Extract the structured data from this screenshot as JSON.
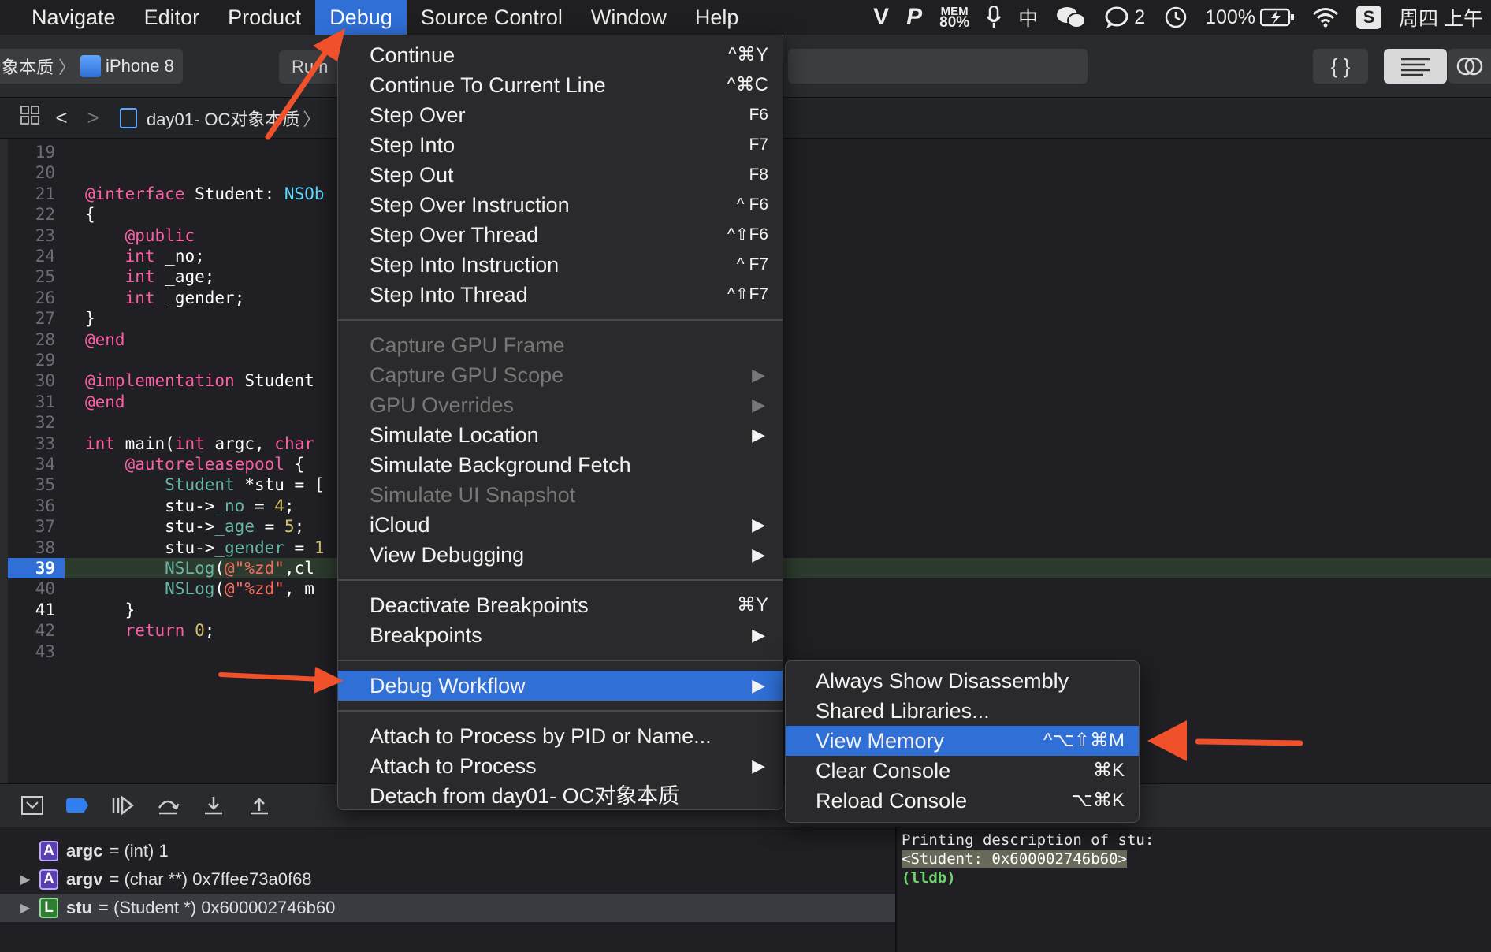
{
  "menubar": {
    "items": [
      "Navigate",
      "Editor",
      "Product",
      "Debug",
      "Source Control",
      "Window",
      "Help"
    ],
    "status": {
      "mem_label": "MEM",
      "mem_value": "80%",
      "input_method": "中",
      "chat_count": "2",
      "battery": "100%",
      "date": "周四 上午"
    }
  },
  "toolbar": {
    "scheme_project": "象本质",
    "scheme_device": "iPhone 8",
    "run_partial": "Ru n"
  },
  "jumpbar": {
    "path": "day01- OC对象本质"
  },
  "editor": {
    "current_line": 39,
    "lines": [
      {
        "n": "19",
        "code": ""
      },
      {
        "n": "20",
        "code": ""
      },
      {
        "n": "21",
        "code": "@interface Student: NSOb"
      },
      {
        "n": "22",
        "code": "{"
      },
      {
        "n": "23",
        "code": "    @public"
      },
      {
        "n": "24",
        "code": "    int _no;"
      },
      {
        "n": "25",
        "code": "    int _age;"
      },
      {
        "n": "26",
        "code": "    int _gender;"
      },
      {
        "n": "27",
        "code": "}"
      },
      {
        "n": "28",
        "code": "@end"
      },
      {
        "n": "29",
        "code": ""
      },
      {
        "n": "30",
        "code": "@implementation Student"
      },
      {
        "n": "31",
        "code": "@end"
      },
      {
        "n": "32",
        "code": ""
      },
      {
        "n": "33",
        "code": "int main(int argc, char"
      },
      {
        "n": "34",
        "code": "    @autoreleasepool {"
      },
      {
        "n": "35",
        "code": "        Student *stu = ["
      },
      {
        "n": "36",
        "code": "        stu->_no = 4;"
      },
      {
        "n": "37",
        "code": "        stu->_age = 5;"
      },
      {
        "n": "38",
        "code": "        stu->_gender = 1"
      },
      {
        "n": "39",
        "code": "        NSLog(@\"%zd\",cl"
      },
      {
        "n": "40",
        "code": "        NSLog(@\"%zd\", m"
      },
      {
        "n": "41",
        "code": "    }"
      },
      {
        "n": "42",
        "code": "    return 0;"
      },
      {
        "n": "43",
        "code": ""
      }
    ]
  },
  "debug_menu": {
    "group1": [
      {
        "label": "Continue",
        "shortcut": "^⌘Y"
      },
      {
        "label": "Continue To Current Line",
        "shortcut": "^⌘C"
      },
      {
        "label": "Step Over",
        "shortcut": "F6"
      },
      {
        "label": "Step Into",
        "shortcut": "F7"
      },
      {
        "label": "Step Out",
        "shortcut": "F8"
      },
      {
        "label": "Step Over Instruction",
        "shortcut": "^ F6"
      },
      {
        "label": "Step Over Thread",
        "shortcut": "^⇧F6"
      },
      {
        "label": "Step Into Instruction",
        "shortcut": "^ F7"
      },
      {
        "label": "Step Into Thread",
        "shortcut": "^⇧F7"
      }
    ],
    "group2": [
      {
        "label": "Capture GPU Frame",
        "disabled": true
      },
      {
        "label": "Capture GPU Scope",
        "disabled": true,
        "submenu": true
      },
      {
        "label": "GPU Overrides",
        "disabled": true,
        "submenu": true
      },
      {
        "label": "Simulate Location",
        "submenu": true
      },
      {
        "label": "Simulate Background Fetch"
      },
      {
        "label": "Simulate UI Snapshot",
        "disabled": true
      },
      {
        "label": "iCloud",
        "submenu": true
      },
      {
        "label": "View Debugging",
        "submenu": true
      }
    ],
    "group3": [
      {
        "label": "Deactivate Breakpoints",
        "shortcut": "⌘Y"
      },
      {
        "label": "Breakpoints",
        "submenu": true
      }
    ],
    "group4": [
      {
        "label": "Debug Workflow",
        "submenu": true,
        "highlighted": true
      }
    ],
    "group5": [
      {
        "label": "Attach to Process by PID or Name..."
      },
      {
        "label": "Attach to Process",
        "submenu": true
      },
      {
        "label": "Detach from day01- OC对象本质"
      }
    ]
  },
  "workflow_menu": [
    {
      "label": "Always Show Disassembly",
      "shortcut": ""
    },
    {
      "label": "Shared Libraries...",
      "shortcut": ""
    },
    {
      "label": "View Memory",
      "shortcut": "^⌥⇧⌘M",
      "highlighted": true
    },
    {
      "label": "Clear Console",
      "shortcut": "⌘K"
    },
    {
      "label": "Reload Console",
      "shortcut": "⌥⌘K"
    }
  ],
  "variables": [
    {
      "badge": "A",
      "name": "argc",
      "value": "= (int) 1",
      "expandable": false
    },
    {
      "badge": "A",
      "name": "argv",
      "value": "= (char **) 0x7ffee73a0f68",
      "expandable": true
    },
    {
      "badge": "L",
      "name": "stu",
      "value": "= (Student *) 0x600002746b60",
      "expandable": true
    }
  ],
  "console": {
    "line1": "Printing description of stu:",
    "line2": "<Student: 0x600002746b60>",
    "line3": "(lldb)"
  },
  "colors": {
    "accent": "#2f6fd6",
    "annotation_arrow": "#f0502a"
  }
}
